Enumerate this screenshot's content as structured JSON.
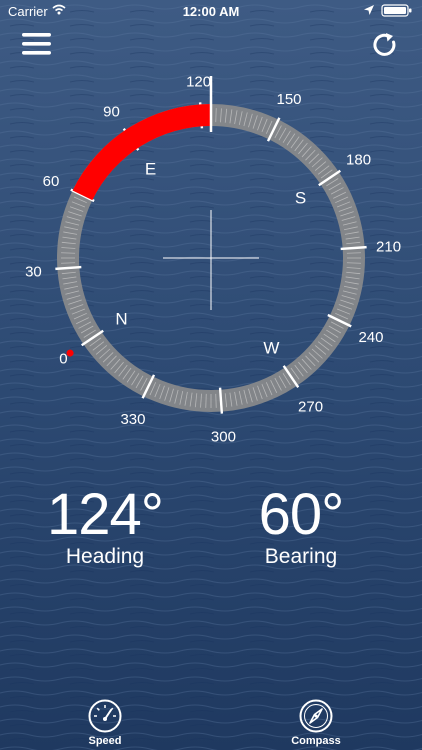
{
  "status_bar": {
    "carrier": "Carrier",
    "time": "12:00 AM"
  },
  "compass": {
    "heading_deg": 124,
    "bearing_deg": 60,
    "ring_labels": [
      "0",
      "30",
      "60",
      "90",
      "120",
      "150",
      "180",
      "210",
      "240",
      "270",
      "300",
      "330"
    ],
    "cardinals": {
      "north": "N",
      "east": "E",
      "south": "S",
      "west": "W"
    },
    "highlight_color": "#ff0000",
    "ring_color": "#8c8c8c"
  },
  "readouts": {
    "heading_value": "124°",
    "heading_label": "Heading",
    "bearing_value": "60°",
    "bearing_label": "Bearing"
  },
  "tabs": [
    {
      "label": "Speed",
      "icon": "speedometer-icon"
    },
    {
      "label": "Compass",
      "icon": "compass-icon"
    }
  ],
  "icons": {
    "menu": "hamburger-menu-icon",
    "refresh": "refresh-icon",
    "wifi": "wifi-icon",
    "location": "location-arrow-icon",
    "battery": "battery-icon"
  }
}
